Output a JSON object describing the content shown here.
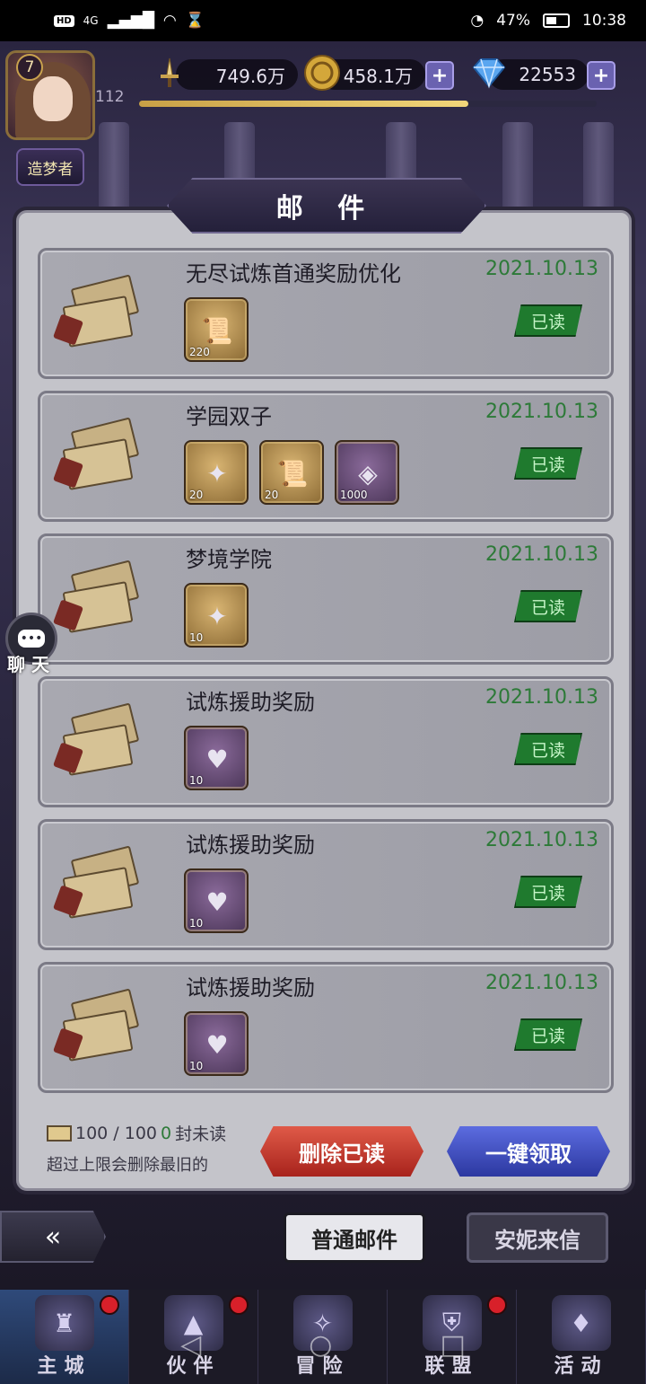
{
  "status_bar": {
    "hd": "HD",
    "network": "4G",
    "battery_pct": "47%",
    "time": "10:38"
  },
  "player": {
    "level": "7",
    "sublevel": "112",
    "title": "造梦者",
    "exp_progress": 0.72
  },
  "resources": {
    "power": "749.6万",
    "gold": "458.1万",
    "diamonds": "22553",
    "plus": "+"
  },
  "panel": {
    "title": "邮 件"
  },
  "mails": [
    {
      "title": "无尽试炼首通奖励优化",
      "date": "2021.10.13",
      "status": "已读",
      "items": [
        {
          "type": "scroll",
          "count": "220",
          "rarity": "gold"
        }
      ]
    },
    {
      "title": "学园双子",
      "date": "2021.10.13",
      "status": "已读",
      "items": [
        {
          "type": "card-pack",
          "count": "20",
          "rarity": "gold"
        },
        {
          "type": "scroll",
          "count": "20",
          "rarity": "gold"
        },
        {
          "type": "rune-stone",
          "count": "1000",
          "rarity": "purple"
        }
      ]
    },
    {
      "title": "梦境学院",
      "date": "2021.10.13",
      "status": "已读",
      "items": [
        {
          "type": "card-pack",
          "count": "10",
          "rarity": "gold"
        }
      ]
    },
    {
      "title": "试炼援助奖励",
      "date": "2021.10.13",
      "status": "已读",
      "items": [
        {
          "type": "heart-coin",
          "count": "10",
          "rarity": "purple"
        }
      ]
    },
    {
      "title": "试炼援助奖励",
      "date": "2021.10.13",
      "status": "已读",
      "items": [
        {
          "type": "heart-coin",
          "count": "10",
          "rarity": "purple"
        }
      ]
    },
    {
      "title": "试炼援助奖励",
      "date": "2021.10.13",
      "status": "已读",
      "items": [
        {
          "type": "heart-coin",
          "count": "10",
          "rarity": "purple"
        }
      ]
    }
  ],
  "footer": {
    "mail_count": "100 / 100",
    "unread_count": "0",
    "unread_suffix": "封未读",
    "hint": "超过上限会删除最旧的",
    "delete_read": "删除已读",
    "claim_all": "一键领取"
  },
  "chat": {
    "label": "聊 天"
  },
  "tabs": {
    "normal": "普通邮件",
    "annie": "安妮来信"
  },
  "bottom_nav": [
    {
      "label": "主城",
      "icon": "castle-icon",
      "badge": true,
      "active": true
    },
    {
      "label": "伙伴",
      "icon": "witch-hat-icon",
      "badge": true,
      "active": false
    },
    {
      "label": "冒险",
      "icon": "compass-icon",
      "badge": false,
      "active": false
    },
    {
      "label": "联盟",
      "icon": "shield-icon",
      "badge": true,
      "active": false
    },
    {
      "label": "活动",
      "icon": "cards-icon",
      "badge": false,
      "active": false
    }
  ],
  "colors": {
    "date_green": "#2d7a38",
    "read_badge": "#1f7a2e",
    "delete_red": "#c23a2e",
    "claim_blue": "#3c4cc0",
    "badge_red": "#d8202a"
  }
}
